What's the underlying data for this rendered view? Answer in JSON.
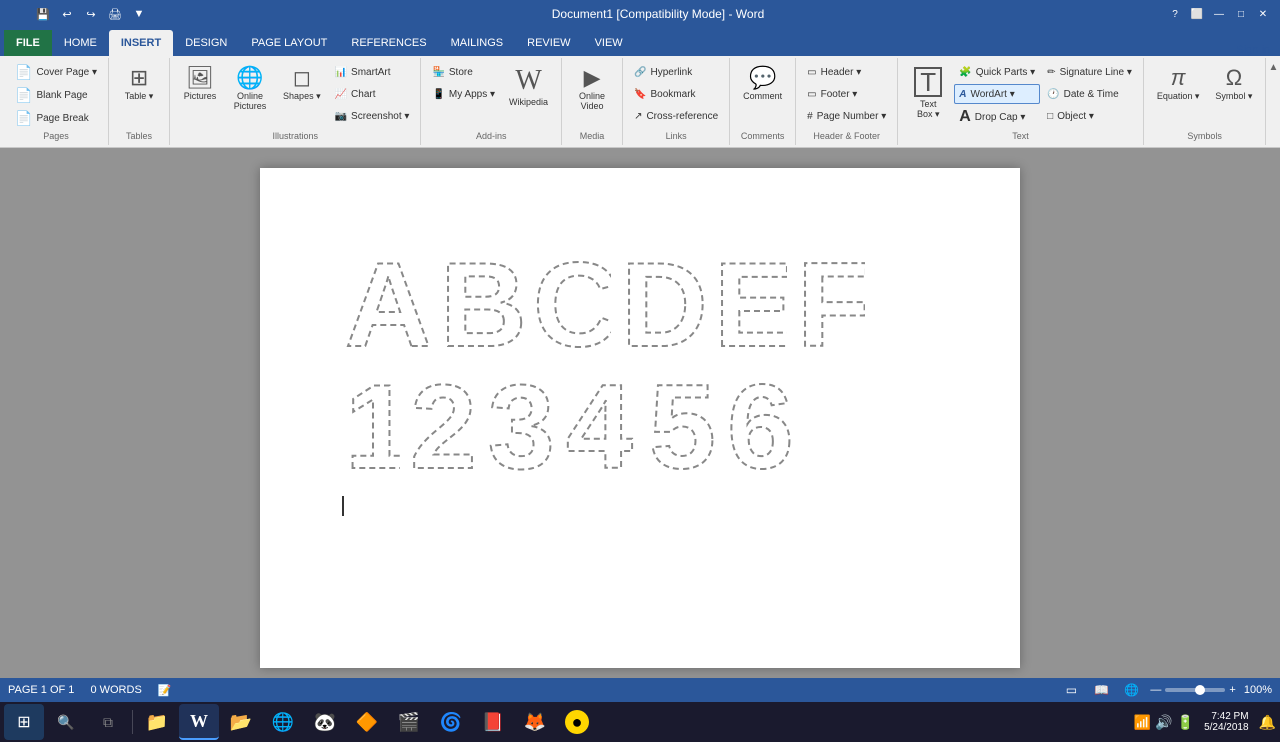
{
  "titlebar": {
    "title": "Document1 [Compatibility Mode] - Word",
    "qat_buttons": [
      "💾",
      "↩",
      "↪",
      "📄"
    ],
    "controls": [
      "?",
      "⬜",
      "—",
      "✕"
    ]
  },
  "ribbon": {
    "tabs": [
      {
        "id": "file",
        "label": "FILE",
        "active": false,
        "file": true
      },
      {
        "id": "home",
        "label": "HOME",
        "active": false
      },
      {
        "id": "insert",
        "label": "INSERT",
        "active": true
      },
      {
        "id": "design",
        "label": "DESIGN",
        "active": false
      },
      {
        "id": "page-layout",
        "label": "PAGE LAYOUT",
        "active": false
      },
      {
        "id": "references",
        "label": "REFERENCES",
        "active": false
      },
      {
        "id": "mailings",
        "label": "MAILINGS",
        "active": false
      },
      {
        "id": "review",
        "label": "REVIEW",
        "active": false
      },
      {
        "id": "view",
        "label": "VIEW",
        "active": false
      }
    ],
    "groups": [
      {
        "id": "pages",
        "label": "Pages",
        "buttons": [
          {
            "id": "cover-page",
            "label": "Cover Page",
            "large": true,
            "icon": "📄"
          },
          {
            "id": "blank-page",
            "label": "Blank Page",
            "large": false,
            "icon": "📄"
          },
          {
            "id": "page-break",
            "label": "Page Break",
            "large": false,
            "icon": "📄"
          }
        ]
      },
      {
        "id": "tables",
        "label": "Tables",
        "buttons": [
          {
            "id": "table",
            "label": "Table",
            "large": true,
            "icon": "⊞"
          }
        ]
      },
      {
        "id": "illustrations",
        "label": "Illustrations",
        "buttons": [
          {
            "id": "pictures",
            "label": "Pictures",
            "icon": "🖼"
          },
          {
            "id": "online-pictures",
            "label": "Online Pictures",
            "icon": "🖼"
          },
          {
            "id": "shapes",
            "label": "Shapes",
            "icon": "◻"
          },
          {
            "id": "smartart",
            "label": "SmartArt",
            "icon": "📊"
          },
          {
            "id": "chart",
            "label": "Chart",
            "icon": "📈"
          },
          {
            "id": "screenshot",
            "label": "Screenshot",
            "icon": "📷"
          }
        ]
      },
      {
        "id": "addins",
        "label": "Add-ins",
        "buttons": [
          {
            "id": "store",
            "label": "Store",
            "icon": "🏪"
          },
          {
            "id": "my-apps",
            "label": "My Apps",
            "icon": "📱"
          },
          {
            "id": "wikipedia",
            "label": "Wikipedia",
            "icon": "W"
          }
        ]
      },
      {
        "id": "media",
        "label": "Media",
        "buttons": [
          {
            "id": "online-video",
            "label": "Online Video",
            "icon": "▶"
          }
        ]
      },
      {
        "id": "links",
        "label": "Links",
        "buttons": [
          {
            "id": "hyperlink",
            "label": "Hyperlink",
            "icon": "🔗"
          },
          {
            "id": "bookmark",
            "label": "Bookmark",
            "icon": "🔖"
          },
          {
            "id": "cross-reference",
            "label": "Cross-reference",
            "icon": "↗"
          }
        ]
      },
      {
        "id": "comments",
        "label": "Comments",
        "buttons": [
          {
            "id": "comment",
            "label": "Comment",
            "icon": "💬"
          }
        ]
      },
      {
        "id": "header-footer",
        "label": "Header & Footer",
        "buttons": [
          {
            "id": "header",
            "label": "Header",
            "icon": "▭"
          },
          {
            "id": "footer",
            "label": "Footer",
            "icon": "▭"
          },
          {
            "id": "page-number",
            "label": "Page Number",
            "icon": "#"
          }
        ]
      },
      {
        "id": "text",
        "label": "Text",
        "buttons": [
          {
            "id": "text-box",
            "label": "Text Box",
            "large": true,
            "icon": "T"
          },
          {
            "id": "quick-parts",
            "label": "Quick Parts ▾",
            "icon": ""
          },
          {
            "id": "wordart",
            "label": "WordArt ▾",
            "icon": "A",
            "highlighted": true
          },
          {
            "id": "drop-cap",
            "label": "Drop Cap ▾",
            "icon": "A"
          },
          {
            "id": "signature-line",
            "label": "Signature Line",
            "icon": "✏"
          },
          {
            "id": "date-time",
            "label": "Date & Time",
            "icon": "🕐"
          },
          {
            "id": "object",
            "label": "Object",
            "icon": "□"
          }
        ]
      },
      {
        "id": "symbols",
        "label": "Symbols",
        "buttons": [
          {
            "id": "equation",
            "label": "Equation",
            "icon": "π"
          },
          {
            "id": "symbol",
            "label": "Symbol",
            "icon": "Ω"
          }
        ]
      }
    ]
  },
  "document": {
    "letters_row1": [
      "A",
      "B",
      "C",
      "D",
      "E",
      "F"
    ],
    "letters_row2": [
      "1",
      "2",
      "3",
      "4",
      "5",
      "6"
    ]
  },
  "statusbar": {
    "page": "PAGE 1 OF 1",
    "words": "0 WORDS",
    "zoom": "100%"
  },
  "taskbar": {
    "time": "7:42 PM",
    "date": "5/24/2018",
    "apps": [
      {
        "id": "start",
        "icon": "⊞",
        "color": "#0078d7"
      },
      {
        "id": "explorer",
        "icon": "📁",
        "color": "#f9a825"
      },
      {
        "id": "word",
        "icon": "W",
        "color": "#2b579a"
      },
      {
        "id": "word2",
        "icon": "W",
        "color": "#2b579a"
      },
      {
        "id": "files",
        "icon": "📂",
        "color": "#888"
      },
      {
        "id": "chrome",
        "icon": "◉",
        "color": "#4285f4"
      },
      {
        "id": "app5",
        "icon": "🐼",
        "color": "#e53935"
      },
      {
        "id": "vlc",
        "icon": "🔶",
        "color": "#f57c00"
      },
      {
        "id": "video",
        "icon": "🎬",
        "color": "#555"
      },
      {
        "id": "firefox-alt",
        "icon": "🌀",
        "color": "#ff9800"
      },
      {
        "id": "pdf",
        "icon": "📕",
        "color": "#e53935"
      },
      {
        "id": "firefox",
        "icon": "🦊",
        "color": "#ff6d00"
      },
      {
        "id": "camera",
        "icon": "🟡",
        "color": "#ffd600"
      }
    ]
  }
}
